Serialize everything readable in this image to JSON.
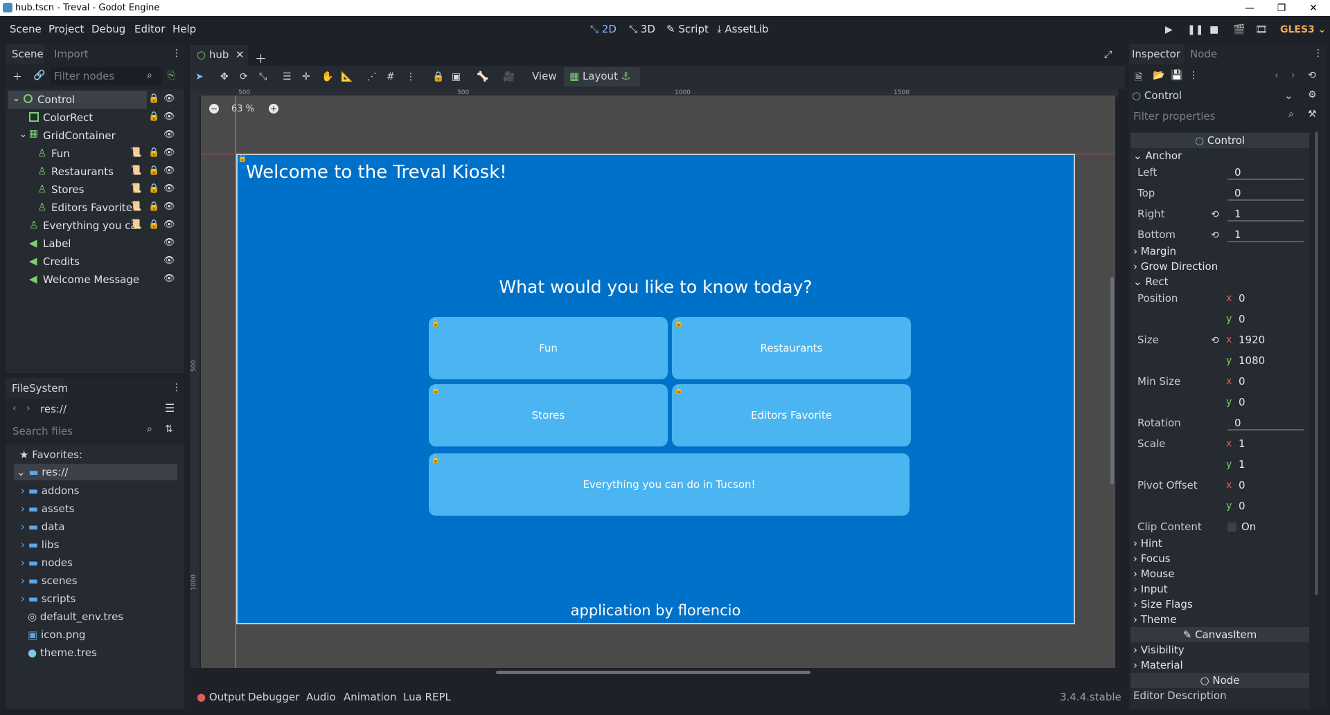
{
  "window": {
    "title": "hub.tscn - Treval - Godot Engine"
  },
  "menu": [
    "Scene",
    "Project",
    "Debug",
    "Editor",
    "Help"
  ],
  "modes": {
    "m2d": "2D",
    "m3d": "3D",
    "script": "Script",
    "assetlib": "AssetLib"
  },
  "renderer": "GLES3",
  "scene_dock": {
    "tabs": {
      "scene": "Scene",
      "import": "Import"
    },
    "filter_placeholder": "Filter nodes",
    "nodes": [
      {
        "label": "Control"
      },
      {
        "label": "ColorRect"
      },
      {
        "label": "GridContainer"
      },
      {
        "label": "Fun"
      },
      {
        "label": "Restaurants"
      },
      {
        "label": "Stores"
      },
      {
        "label": "Editors Favorite"
      },
      {
        "label": "Everything you ca"
      },
      {
        "label": "Label"
      },
      {
        "label": "Credits"
      },
      {
        "label": "Welcome Message"
      }
    ]
  },
  "filesystem": {
    "title": "FileSystem",
    "path": "res://",
    "search_placeholder": "Search files",
    "favorites": "Favorites:",
    "root": "res://",
    "items": [
      "addons",
      "assets",
      "data",
      "libs",
      "nodes",
      "scenes",
      "scripts",
      "default_env.tres",
      "icon.png",
      "theme.tres"
    ]
  },
  "editor_tab": {
    "name": "hub"
  },
  "toolbar": {
    "view": "View",
    "layout": "Layout"
  },
  "zoom": "63 %",
  "ruler": {
    "t500": "500",
    "t1000": "1000",
    "t1500": "1500",
    "v500": "500",
    "v1000": "1000"
  },
  "kiosk": {
    "welcome": "Welcome to the Treval Kiosk!",
    "question": "What would you like to know today?",
    "buttons": {
      "fun": "Fun",
      "restaurants": "Restaurants",
      "stores": "Stores",
      "editors": "Editors Favorite",
      "everything": "Everything you can do in Tucson!"
    },
    "credits": "application by florencio"
  },
  "bottom_tabs": {
    "output": "Output",
    "debugger": "Debugger",
    "audio": "Audio",
    "animation": "Animation",
    "lua": "Lua REPL"
  },
  "version": "3.4.4.stable",
  "inspector": {
    "tabs": {
      "inspector": "Inspector",
      "node": "Node"
    },
    "node_name": "Control",
    "filter_placeholder": "Filter properties",
    "class": "Control",
    "anchor": {
      "title": "Anchor",
      "left_l": "Left",
      "left_v": "0",
      "top_l": "Top",
      "top_v": "0",
      "right_l": "Right",
      "right_v": "1",
      "bottom_l": "Bottom",
      "bottom_v": "1"
    },
    "sections": {
      "margin": "Margin",
      "grow": "Grow Direction",
      "rect": "Rect"
    },
    "rect": {
      "position_l": "Position",
      "pos_x": "0",
      "pos_y": "0",
      "size_l": "Size",
      "size_x": "1920",
      "size_y": "1080",
      "minsize_l": "Min Size",
      "min_x": "0",
      "min_y": "0",
      "rotation_l": "Rotation",
      "rotation_v": "0",
      "scale_l": "Scale",
      "scale_x": "1",
      "scale_y": "1",
      "pivot_l": "Pivot Offset",
      "pivot_x": "0",
      "pivot_y": "0"
    },
    "clip_l": "Clip Content",
    "clip_v": "On",
    "more": {
      "hint": "Hint",
      "focus": "Focus",
      "mouse": "Mouse",
      "input": "Input",
      "sizeflags": "Size Flags",
      "theme": "Theme"
    },
    "canvasitem": "CanvasItem",
    "ci": {
      "visibility": "Visibility",
      "material": "Material"
    },
    "node_cat": "Node",
    "editor_desc": "Editor Description",
    "axis": {
      "x": "x",
      "y": "y"
    }
  }
}
